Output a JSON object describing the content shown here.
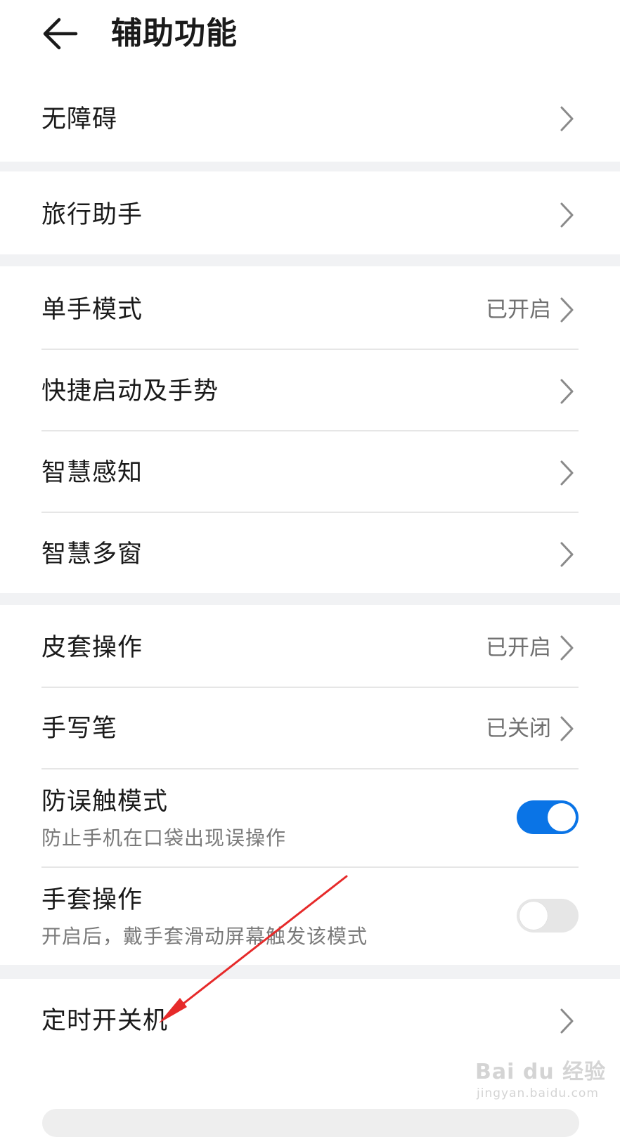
{
  "header": {
    "title": "辅助功能",
    "back_icon": "arrow-left-icon"
  },
  "rows": {
    "accessibility": {
      "label": "无障碍"
    },
    "travel_assistant": {
      "label": "旅行助手"
    },
    "one_hand_mode": {
      "label": "单手模式",
      "status": "已开启"
    },
    "shortcuts_gestures": {
      "label": "快捷启动及手势"
    },
    "smart_awareness": {
      "label": "智慧感知"
    },
    "smart_multiwindow": {
      "label": "智慧多窗"
    },
    "cover_operation": {
      "label": "皮套操作",
      "status": "已开启"
    },
    "stylus": {
      "label": "手写笔",
      "status": "已关闭"
    },
    "pocket_mode": {
      "label": "防误触模式",
      "subtitle": "防止手机在口袋出现误操作",
      "enabled": true
    },
    "glove_mode": {
      "label": "手套操作",
      "subtitle": "开启后，戴手套滑动屏幕触发该模式",
      "enabled": false
    },
    "scheduled_power": {
      "label": "定时开关机"
    }
  },
  "colors": {
    "accent": "#0a74e6",
    "annotation_arrow": "#e62a2a",
    "section_gap": "#f1f2f4"
  },
  "watermark": {
    "logo": "Bai du 经验",
    "url": "jingyan.baidu.com"
  }
}
